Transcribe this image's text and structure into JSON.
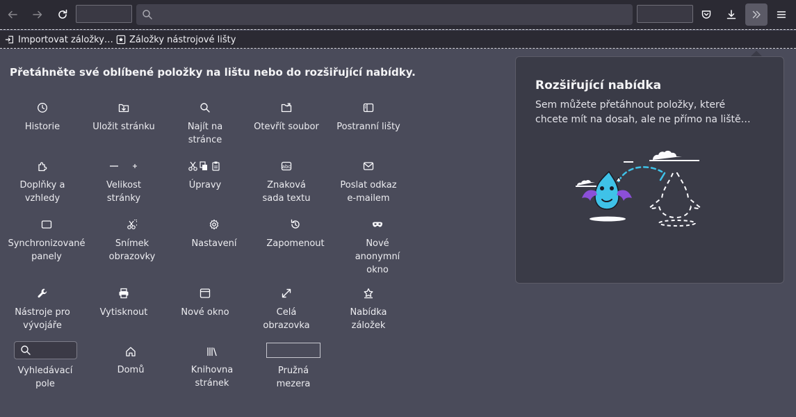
{
  "toolbar": {
    "back_icon": "arrow-left-icon",
    "forward_icon": "arrow-right-icon",
    "reload_icon": "reload-icon",
    "url_placeholder": "",
    "pocket_icon": "pocket-icon",
    "downloads_icon": "download-icon",
    "overflow_icon": "double-chevron-icon",
    "menu_icon": "hamburger-icon"
  },
  "bookmarks": {
    "import_label": "Importovat záložky…",
    "toolbar_bookmarks_label": "Záložky nástrojové lišty"
  },
  "palette": {
    "title": "Přetáhněte své oblíbené položky na lištu nebo do rozšiřující nabídky.",
    "items": [
      {
        "label": "Historie",
        "icon": "clock-icon"
      },
      {
        "label": "Uložit stránku",
        "icon": "save-page-icon"
      },
      {
        "label": "Najít na stránce",
        "icon": "search-icon"
      },
      {
        "label": "Otevřít soubor",
        "icon": "open-folder-icon"
      },
      {
        "label": "Postranní lišty",
        "icon": "sidebar-icon"
      },
      {
        "label": "Doplňky a vzhledy",
        "icon": "puzzle-icon"
      },
      {
        "label": "Velikost stránky",
        "icon": "zoom-icon"
      },
      {
        "label": "Úpravy",
        "icon": "cut-copy-paste-icon"
      },
      {
        "label": "Znaková sada textu",
        "icon": "text-encoding-icon"
      },
      {
        "label": "Poslat odkaz e-mailem",
        "icon": "mail-icon"
      },
      {
        "label": "Synchronizované panely",
        "icon": "synced-tabs-icon"
      },
      {
        "label": "Snímek obrazovky",
        "icon": "screenshot-icon"
      },
      {
        "label": "Nastavení",
        "icon": "gear-icon"
      },
      {
        "label": "Zapomenout",
        "icon": "forget-icon"
      },
      {
        "label": "Nové anonymní okno",
        "icon": "private-mask-icon"
      },
      {
        "label": "Nástroje pro vývojáře",
        "icon": "wrench-icon"
      },
      {
        "label": "Vytisknout",
        "icon": "printer-icon"
      },
      {
        "label": "Nové okno",
        "icon": "new-window-icon"
      },
      {
        "label": "Celá obrazovka",
        "icon": "fullscreen-icon"
      },
      {
        "label": "Nabídka záložek",
        "icon": "bookmark-star-icon"
      },
      {
        "label": "Vyhledávací pole",
        "icon": "search-field-icon"
      },
      {
        "label": "Domů",
        "icon": "home-icon"
      },
      {
        "label": "Knihovna stránek",
        "icon": "library-icon"
      },
      {
        "label": "Pružná mezera",
        "icon": "flexible-space-icon"
      }
    ]
  },
  "overflow_panel": {
    "title": "Rozšiřující nabídka",
    "description": "Sem můžete přetáhnout položky, které chcete mít na dosah, ale ne přímo na liště…"
  },
  "colors": {
    "toolbar_bg": "#2b2a33",
    "customize_bg": "#4a4b5a",
    "panel_bg": "#3a3b47",
    "accent_cyan": "#3fc2e8",
    "accent_purple": "#8b4fd8"
  }
}
